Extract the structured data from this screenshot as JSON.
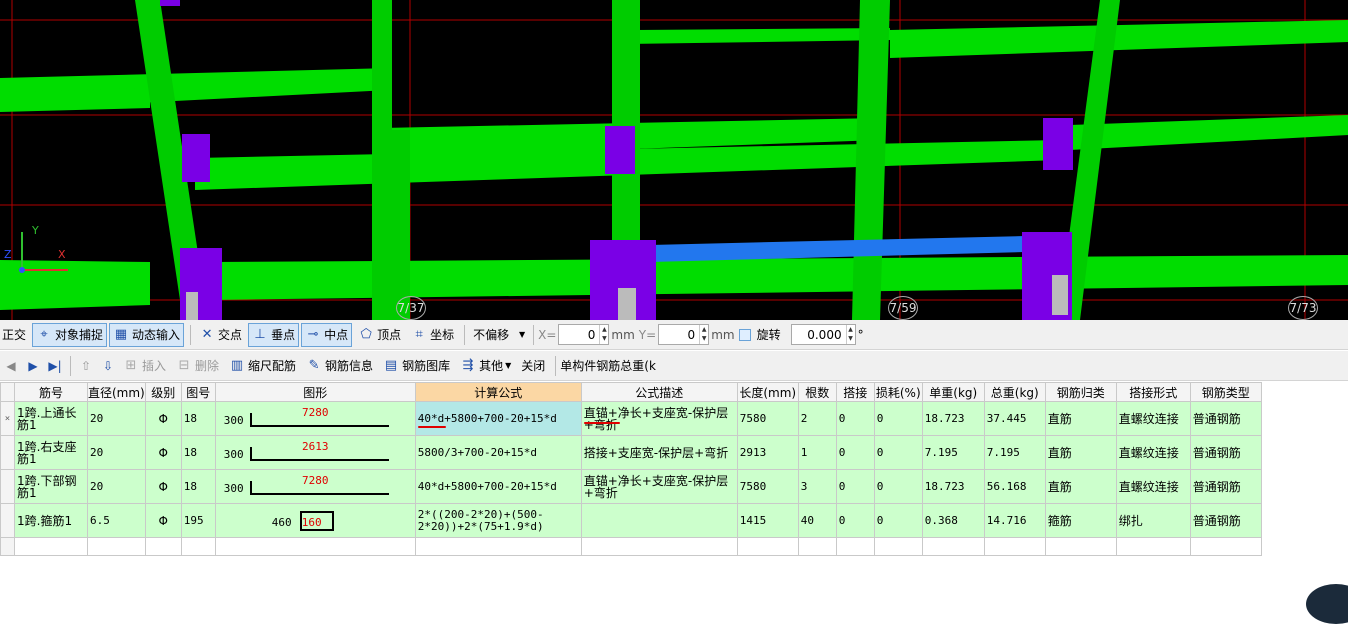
{
  "viewport": {
    "axis_labels": {
      "y": "Y",
      "x": "X",
      "z": "Z"
    },
    "grid_numbers": [
      "7/37",
      "7/59",
      "7/73"
    ]
  },
  "snap_toolbar": {
    "ortho": "正交",
    "object_snap": "对象捕捉",
    "dynamic_input": "动态输入",
    "intersection": "交点",
    "perpendicular": "垂点",
    "midpoint": "中点",
    "vertex": "顶点",
    "coordinate": "坐标",
    "offset_mode": "不偏移",
    "x_label": "X=",
    "x_value": "0",
    "unit_mm_1": "mm",
    "y_label": "Y=",
    "y_value": "0",
    "unit_mm_2": "mm",
    "rotate_label": "旋转",
    "rotate_value": "0.000",
    "degree": "°"
  },
  "rebar_toolbar": {
    "insert": "插入",
    "delete": "删除",
    "scale_rebar": "缩尺配筋",
    "rebar_info": "钢筋信息",
    "rebar_library": "钢筋图库",
    "other": "其他",
    "close": "关闭",
    "total_weight": "单构件钢筋总重(k"
  },
  "table": {
    "columns": [
      "筋号",
      "直径(mm)",
      "级别",
      "图号",
      "图形",
      "计算公式",
      "公式描述",
      "长度(mm)",
      "根数",
      "搭接",
      "损耗(%)",
      "单重(kg)",
      "总重(kg)",
      "钢筋归类",
      "搭接形式",
      "钢筋类型"
    ],
    "rows": [
      {
        "mark": "1跨.上通长筋1",
        "diameter": "20",
        "grade": "Φ",
        "fig_no": "18",
        "shape_left": "300",
        "shape_len": "7280",
        "formula": "40*d+5800+700-20+15*d",
        "desc": "直锚+净长+支座宽-保护层+弯折",
        "length": "7580",
        "count": "2",
        "lap": "0",
        "loss": "0",
        "unit_wt": "18.723",
        "total_wt": "37.445",
        "category": "直筋",
        "lap_type": "直螺纹连接",
        "rebar_type": "普通钢筋"
      },
      {
        "mark": "1跨.右支座筋1",
        "diameter": "20",
        "grade": "Φ",
        "fig_no": "18",
        "shape_left": "300",
        "shape_len": "2613",
        "formula": "5800/3+700-20+15*d",
        "desc": "搭接+支座宽-保护层+弯折",
        "length": "2913",
        "count": "1",
        "lap": "0",
        "loss": "0",
        "unit_wt": "7.195",
        "total_wt": "7.195",
        "category": "直筋",
        "lap_type": "直螺纹连接",
        "rebar_type": "普通钢筋"
      },
      {
        "mark": "1跨.下部钢筋1",
        "diameter": "20",
        "grade": "Φ",
        "fig_no": "18",
        "shape_left": "300",
        "shape_len": "7280",
        "formula": "40*d+5800+700-20+15*d",
        "desc": "直锚+净长+支座宽-保护层+弯折",
        "length": "7580",
        "count": "3",
        "lap": "0",
        "loss": "0",
        "unit_wt": "18.723",
        "total_wt": "56.168",
        "category": "直筋",
        "lap_type": "直螺纹连接",
        "rebar_type": "普通钢筋"
      },
      {
        "mark": "1跨.箍筋1",
        "diameter": "6.5",
        "grade": "Φ",
        "fig_no": "195",
        "shape_left": "460",
        "shape_len": "160",
        "formula": "2*((200-2*20)+(500-2*20))+2*(75+1.9*d)",
        "desc": "",
        "length": "1415",
        "count": "40",
        "lap": "0",
        "loss": "0",
        "unit_wt": "0.368",
        "total_wt": "14.716",
        "category": "箍筋",
        "lap_type": "绑扎",
        "rebar_type": "普通钢筋"
      }
    ]
  }
}
